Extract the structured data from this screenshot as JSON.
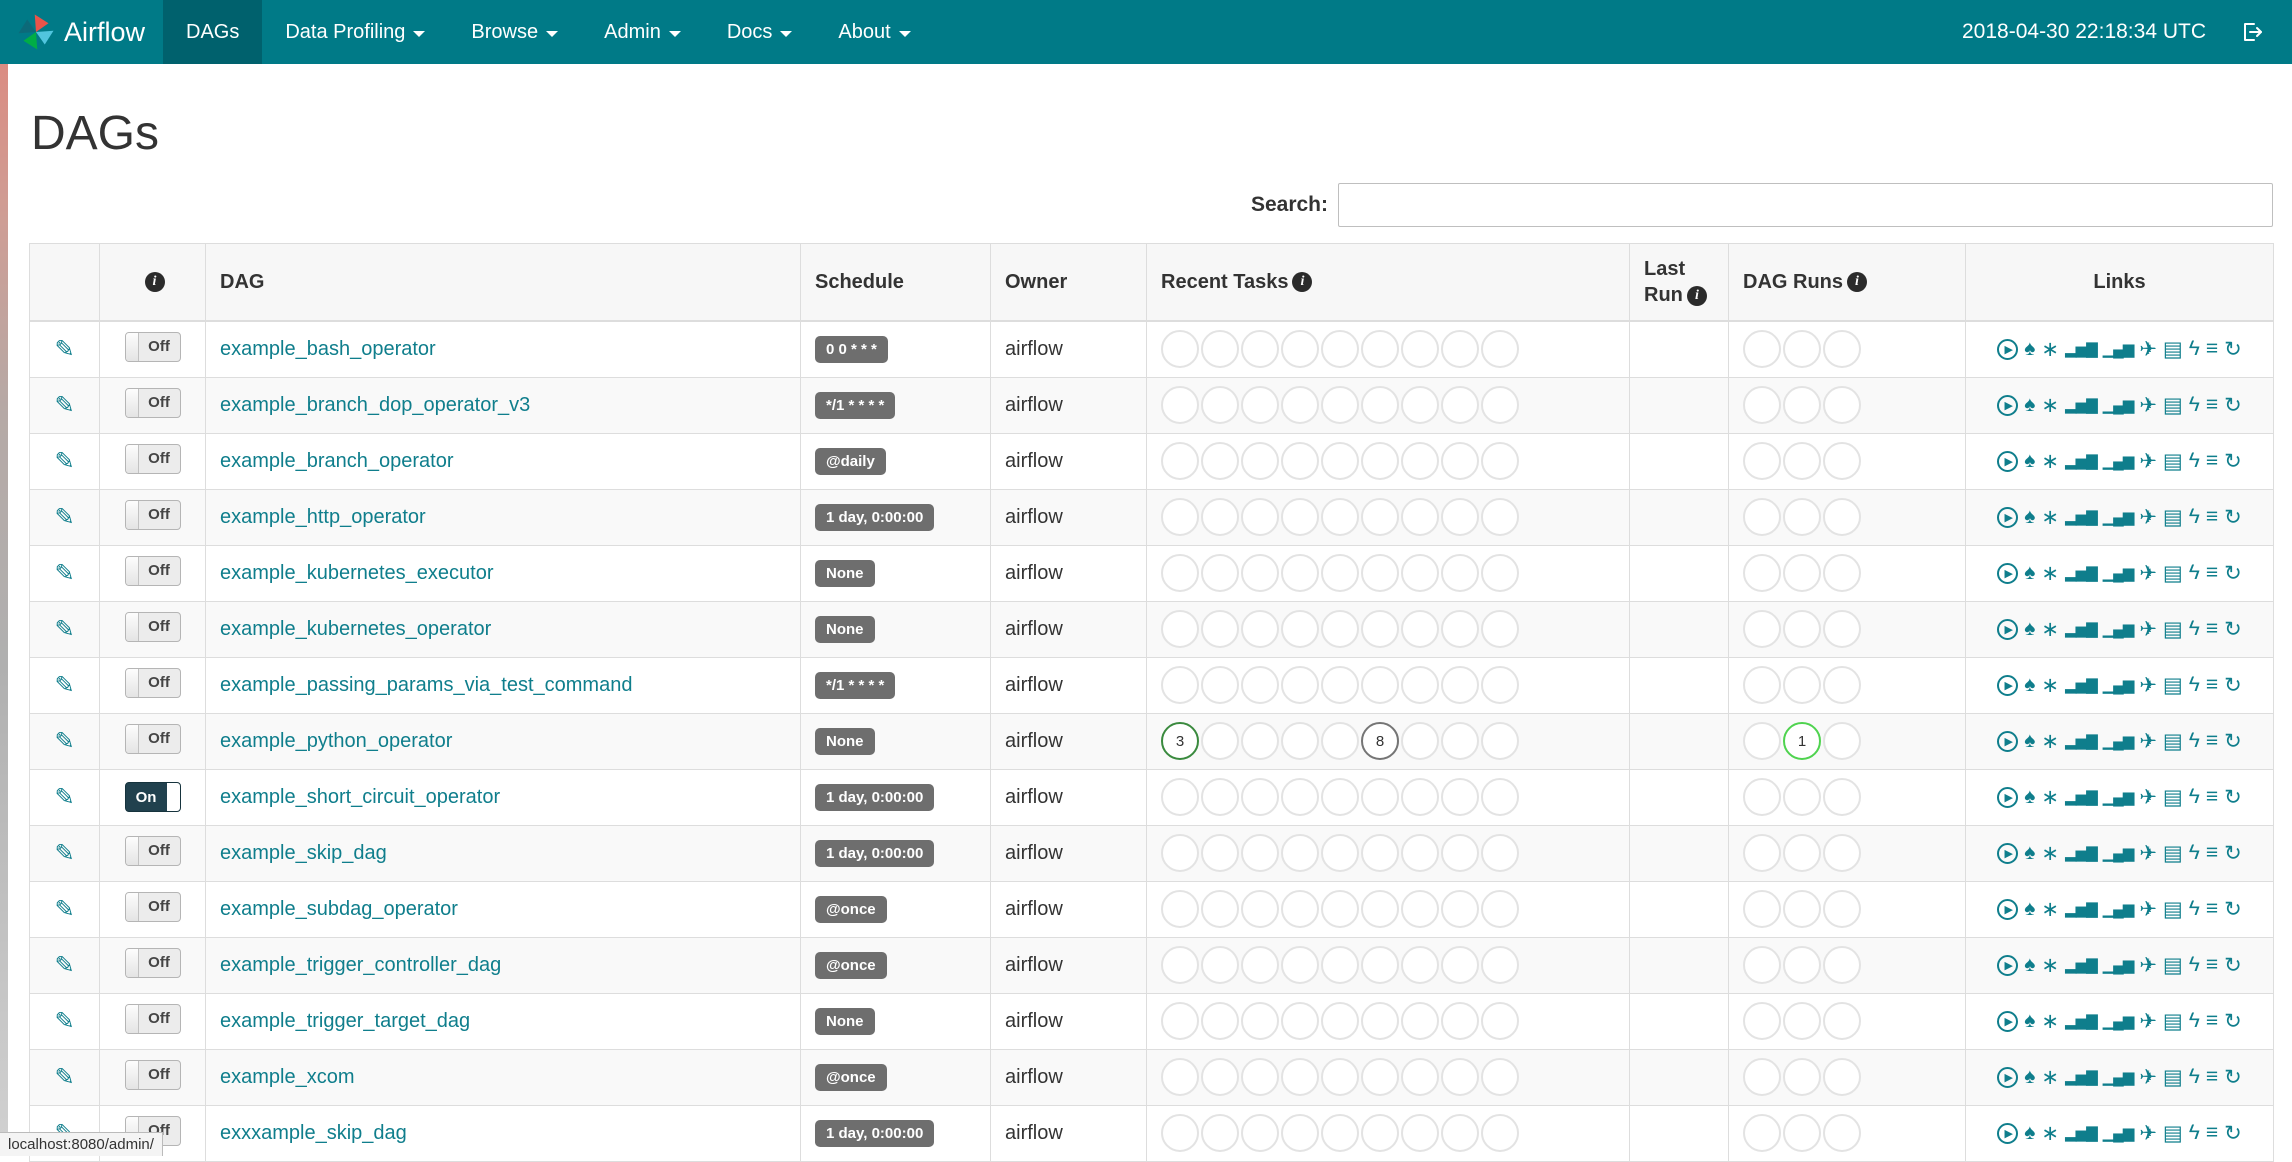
{
  "navbar": {
    "brand": "Airflow",
    "items": [
      {
        "label": "DAGs",
        "active": true,
        "dropdown": false
      },
      {
        "label": "Data Profiling",
        "active": false,
        "dropdown": true
      },
      {
        "label": "Browse",
        "active": false,
        "dropdown": true
      },
      {
        "label": "Admin",
        "active": false,
        "dropdown": true
      },
      {
        "label": "Docs",
        "active": false,
        "dropdown": true
      },
      {
        "label": "About",
        "active": false,
        "dropdown": true
      }
    ],
    "clock": "2018-04-30 22:18:34 UTC"
  },
  "page": {
    "title": "DAGs"
  },
  "search": {
    "label": "Search:",
    "value": "",
    "placeholder": ""
  },
  "table": {
    "headers": {
      "dag": "DAG",
      "schedule": "Schedule",
      "owner": "Owner",
      "recent_tasks": "Recent Tasks",
      "last_run_line1": "Last",
      "last_run_line2": "Run",
      "dag_runs": "DAG Runs",
      "links": "Links"
    },
    "info_glyph": "i",
    "edit_icon_glyph": "✎",
    "toggle_labels": {
      "on": "On",
      "off": "Off"
    },
    "recent_task_slots": 9,
    "dag_run_slots": 3,
    "links_icons": [
      {
        "name": "trigger-dag-icon",
        "glyph": "▶",
        "ring": true,
        "bars": false
      },
      {
        "name": "tree-view-icon",
        "glyph": "♠",
        "ring": false,
        "bars": false
      },
      {
        "name": "graph-view-icon",
        "glyph": "∗",
        "ring": false,
        "bars": false
      },
      {
        "name": "task-duration-icon",
        "glyph": "▂▅▇",
        "ring": false,
        "bars": true
      },
      {
        "name": "task-tries-icon",
        "glyph": "▁▄▆",
        "ring": false,
        "bars": true
      },
      {
        "name": "landing-times-icon",
        "glyph": "✈",
        "ring": false,
        "bars": false
      },
      {
        "name": "gantt-view-icon",
        "glyph": "▤",
        "ring": false,
        "bars": false
      },
      {
        "name": "code-view-icon",
        "glyph": "ϟ",
        "ring": false,
        "bars": false
      },
      {
        "name": "logs-icon",
        "glyph": "≡",
        "ring": false,
        "bars": false
      },
      {
        "name": "refresh-icon",
        "glyph": "↻",
        "ring": false,
        "bars": false
      }
    ],
    "rows": [
      {
        "dag": "example_bash_operator",
        "schedule": "0 0 * * *",
        "owner": "airflow",
        "enabled": false,
        "recent_tasks": [],
        "dag_runs": []
      },
      {
        "dag": "example_branch_dop_operator_v3",
        "schedule": "*/1 * * * *",
        "owner": "airflow",
        "enabled": false,
        "recent_tasks": [],
        "dag_runs": []
      },
      {
        "dag": "example_branch_operator",
        "schedule": "@daily",
        "owner": "airflow",
        "enabled": false,
        "recent_tasks": [],
        "dag_runs": []
      },
      {
        "dag": "example_http_operator",
        "schedule": "1 day, 0:00:00",
        "owner": "airflow",
        "enabled": false,
        "recent_tasks": [],
        "dag_runs": []
      },
      {
        "dag": "example_kubernetes_executor",
        "schedule": "None",
        "owner": "airflow",
        "enabled": false,
        "recent_tasks": [],
        "dag_runs": []
      },
      {
        "dag": "example_kubernetes_operator",
        "schedule": "None",
        "owner": "airflow",
        "enabled": false,
        "recent_tasks": [],
        "dag_runs": []
      },
      {
        "dag": "example_passing_params_via_test_command",
        "schedule": "*/1 * * * *",
        "owner": "airflow",
        "enabled": false,
        "recent_tasks": [],
        "dag_runs": []
      },
      {
        "dag": "example_python_operator",
        "schedule": "None",
        "owner": "airflow",
        "enabled": false,
        "recent_tasks": [
          {
            "slot": 0,
            "value": "3",
            "color": "#3a8a3e"
          },
          {
            "slot": 5,
            "value": "8",
            "color": "#757575"
          }
        ],
        "dag_runs": [
          {
            "slot": 1,
            "value": "1",
            "color": "#4fd34f"
          }
        ]
      },
      {
        "dag": "example_short_circuit_operator",
        "schedule": "1 day, 0:00:00",
        "owner": "airflow",
        "enabled": true,
        "recent_tasks": [],
        "dag_runs": []
      },
      {
        "dag": "example_skip_dag",
        "schedule": "1 day, 0:00:00",
        "owner": "airflow",
        "enabled": false,
        "recent_tasks": [],
        "dag_runs": []
      },
      {
        "dag": "example_subdag_operator",
        "schedule": "@once",
        "owner": "airflow",
        "enabled": false,
        "recent_tasks": [],
        "dag_runs": []
      },
      {
        "dag": "example_trigger_controller_dag",
        "schedule": "@once",
        "owner": "airflow",
        "enabled": false,
        "recent_tasks": [],
        "dag_runs": []
      },
      {
        "dag": "example_trigger_target_dag",
        "schedule": "None",
        "owner": "airflow",
        "enabled": false,
        "recent_tasks": [],
        "dag_runs": []
      },
      {
        "dag": "example_xcom",
        "schedule": "@once",
        "owner": "airflow",
        "enabled": false,
        "recent_tasks": [],
        "dag_runs": []
      },
      {
        "dag": "exxxample_skip_dag",
        "schedule": "1 day, 0:00:00",
        "owner": "airflow",
        "enabled": false,
        "recent_tasks": [],
        "dag_runs": []
      }
    ]
  },
  "status_bar": {
    "url": "localhost:8080/admin/"
  },
  "colors": {
    "navbar_bg": "#007A87",
    "navbar_active_bg": "#00616d",
    "link_teal": "#0f7e8c",
    "badge_bg": "#6e6e6e",
    "success_green": "#3a8a3e",
    "running_green": "#4fd34f",
    "queued_grey": "#757575"
  }
}
